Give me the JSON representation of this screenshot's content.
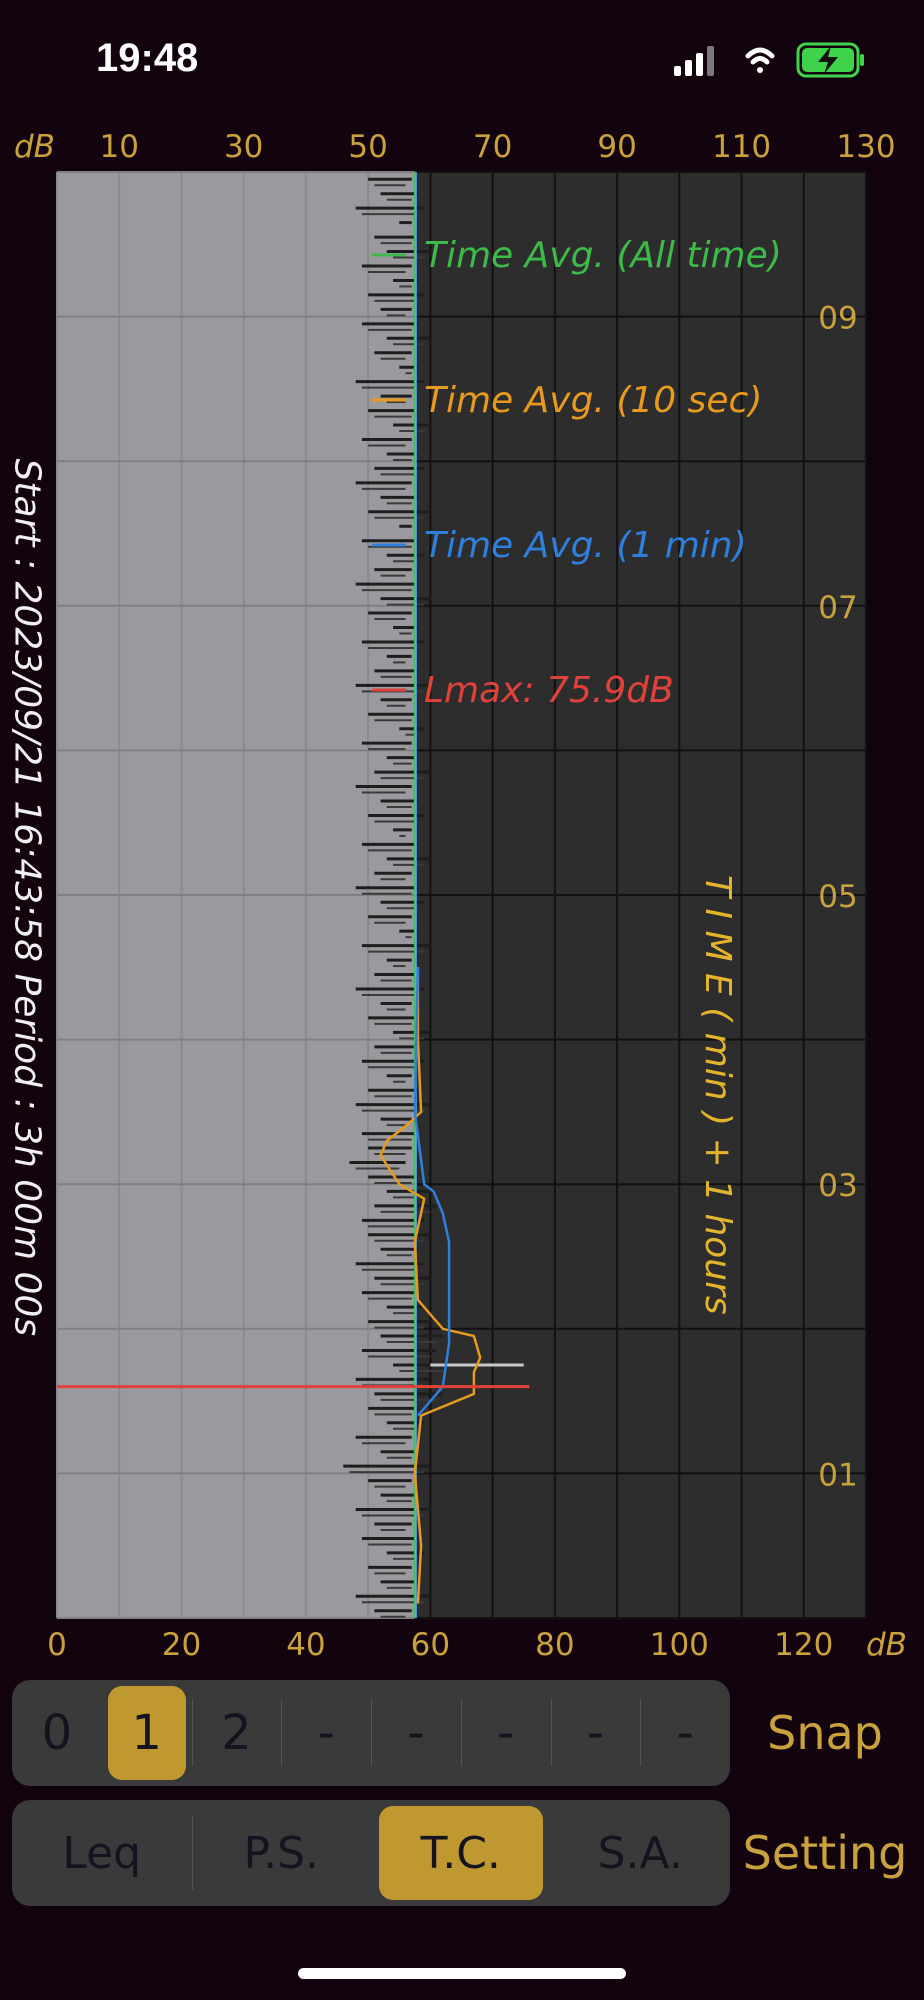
{
  "status_bar": {
    "time": "19:48"
  },
  "top_axis": {
    "unit": "dB",
    "labels": [
      "10",
      "30",
      "50",
      "70",
      "90",
      "110",
      "130"
    ]
  },
  "bottom_axis": {
    "unit": "dB",
    "labels": [
      "0",
      "20",
      "40",
      "60",
      "80",
      "100",
      "120"
    ]
  },
  "right_axis": {
    "labels": [
      "09",
      "07",
      "05",
      "03",
      "01"
    ],
    "title": "T I M E ( min ) + 1 hours"
  },
  "left_info": "Start : 2023/09/21 16:43:58  Period : 3h 00m 00s",
  "legend": [
    {
      "label": "Time Avg. (All time)",
      "color": "#3dbb4a"
    },
    {
      "label": "Time Avg. (10 sec)",
      "color": "#e79a1e"
    },
    {
      "label": "Time Avg. (1 min)",
      "color": "#2f7fdc"
    },
    {
      "label": "Lmax: 75.9dB",
      "color": "#e0423a"
    }
  ],
  "colors": {
    "accent": "#bf9830",
    "lmax": "#e0423a",
    "all_time": "#3dbb4a",
    "ten_sec": "#e79a1e",
    "one_min": "#2f7fdc",
    "gray_fill": "#9a9a9e",
    "dark_fill": "#2d2d2d"
  },
  "chart_data": {
    "type": "line",
    "x_axis": "dB",
    "xlim": [
      0,
      130
    ],
    "y_axis": "time (min)",
    "ylim": [
      0,
      10
    ],
    "current_level_db": 57.5,
    "lmax_db": 75.9,
    "lmax_time_min": 1.6,
    "all_time_avg_db": 57.5,
    "series": [
      {
        "name": "Time Avg. (10 sec)",
        "points": [
          [
            58,
            0.1
          ],
          [
            58.5,
            0.5
          ],
          [
            57.5,
            1.0
          ],
          [
            58.5,
            1.4
          ],
          [
            67,
            1.55
          ],
          [
            67,
            1.7
          ],
          [
            68,
            1.8
          ],
          [
            67,
            1.95
          ],
          [
            62,
            2.0
          ],
          [
            58,
            2.2
          ],
          [
            57.5,
            2.6
          ],
          [
            59,
            2.9
          ],
          [
            55,
            3.0
          ],
          [
            52,
            3.2
          ],
          [
            53,
            3.3
          ],
          [
            56,
            3.4
          ],
          [
            58.5,
            3.5
          ],
          [
            58,
            4.0
          ],
          [
            58,
            4.5
          ]
        ]
      },
      {
        "name": "Time Avg. (1 min)",
        "points": [
          [
            58,
            1.4
          ],
          [
            62,
            1.6
          ],
          [
            63,
            1.9
          ],
          [
            63,
            2.6
          ],
          [
            62,
            2.8
          ],
          [
            60.5,
            2.95
          ],
          [
            59,
            3.0
          ],
          [
            57.5,
            3.5
          ],
          [
            58,
            4.5
          ]
        ]
      }
    ],
    "spectrum_dark_bars": [
      [
        9.95,
        57,
        50
      ],
      [
        9.85,
        58,
        52
      ],
      [
        9.75,
        59,
        48
      ],
      [
        9.65,
        57,
        55
      ],
      [
        9.55,
        58,
        51
      ],
      [
        9.45,
        60,
        53
      ],
      [
        9.35,
        57,
        49
      ],
      [
        9.25,
        58,
        54
      ],
      [
        9.15,
        59,
        50
      ],
      [
        9.05,
        57,
        52
      ],
      [
        8.95,
        58,
        49
      ],
      [
        8.85,
        60,
        53
      ],
      [
        8.75,
        57,
        51
      ],
      [
        8.65,
        58,
        55
      ],
      [
        8.55,
        59,
        48
      ],
      [
        8.45,
        57,
        52
      ],
      [
        8.35,
        58,
        50
      ],
      [
        8.25,
        60,
        54
      ],
      [
        8.15,
        57,
        49
      ],
      [
        8.05,
        58,
        53
      ],
      [
        7.95,
        59,
        51
      ],
      [
        7.85,
        57,
        48
      ],
      [
        7.75,
        58,
        52
      ],
      [
        7.65,
        60,
        50
      ],
      [
        7.55,
        57,
        55
      ],
      [
        7.45,
        58,
        49
      ],
      [
        7.35,
        59,
        53
      ],
      [
        7.25,
        57,
        51
      ],
      [
        7.15,
        58,
        48
      ],
      [
        7.05,
        60,
        52
      ],
      [
        6.95,
        57,
        50
      ],
      [
        6.85,
        58,
        54
      ],
      [
        6.75,
        59,
        49
      ],
      [
        6.65,
        57,
        53
      ],
      [
        6.55,
        58,
        51
      ],
      [
        6.45,
        60,
        48
      ],
      [
        6.35,
        57,
        52
      ],
      [
        6.25,
        58,
        50
      ],
      [
        6.15,
        59,
        55
      ],
      [
        6.05,
        57,
        49
      ],
      [
        5.95,
        58,
        53
      ],
      [
        5.85,
        60,
        51
      ],
      [
        5.75,
        57,
        48
      ],
      [
        5.65,
        58,
        52
      ],
      [
        5.55,
        59,
        50
      ],
      [
        5.45,
        57,
        54
      ],
      [
        5.35,
        58,
        49
      ],
      [
        5.25,
        60,
        53
      ],
      [
        5.15,
        57,
        51
      ],
      [
        5.05,
        58,
        48
      ],
      [
        4.95,
        59,
        52
      ],
      [
        4.85,
        57,
        50
      ],
      [
        4.75,
        58,
        55
      ],
      [
        4.65,
        60,
        49
      ],
      [
        4.55,
        57,
        53
      ],
      [
        4.45,
        58,
        51
      ],
      [
        4.35,
        59,
        48
      ],
      [
        4.25,
        57,
        52
      ],
      [
        4.15,
        58,
        50
      ],
      [
        4.05,
        60,
        54
      ],
      [
        3.95,
        58,
        51
      ],
      [
        3.85,
        59,
        49
      ],
      [
        3.75,
        57,
        53
      ],
      [
        3.65,
        58,
        50
      ],
      [
        3.55,
        60,
        48
      ],
      [
        3.45,
        57,
        52
      ],
      [
        3.35,
        58,
        49
      ],
      [
        3.25,
        57,
        50
      ],
      [
        3.15,
        56,
        47
      ],
      [
        3.05,
        58,
        50
      ],
      [
        2.95,
        60,
        53
      ],
      [
        2.85,
        61,
        51
      ],
      [
        2.75,
        59,
        49
      ],
      [
        2.65,
        60,
        50
      ],
      [
        2.55,
        58,
        52
      ],
      [
        2.45,
        59,
        48
      ],
      [
        2.35,
        60,
        51
      ],
      [
        2.25,
        58,
        49
      ],
      [
        2.15,
        59,
        53
      ],
      [
        2.05,
        60,
        50
      ],
      [
        1.95,
        62,
        52
      ],
      [
        1.85,
        61,
        49
      ],
      [
        1.75,
        63,
        54
      ],
      [
        1.65,
        60,
        48
      ],
      [
        1.55,
        62,
        51
      ],
      [
        1.45,
        58,
        50
      ],
      [
        1.35,
        59,
        53
      ],
      [
        1.25,
        57,
        48
      ],
      [
        1.15,
        58,
        52
      ],
      [
        1.05,
        60,
        46
      ],
      [
        0.95,
        57,
        50
      ],
      [
        0.85,
        58,
        52
      ],
      [
        0.75,
        60,
        48
      ],
      [
        0.65,
        57,
        51
      ],
      [
        0.55,
        58,
        49
      ],
      [
        0.45,
        59,
        53
      ],
      [
        0.35,
        57,
        50
      ],
      [
        0.25,
        58,
        52
      ],
      [
        0.15,
        60,
        48
      ],
      [
        0.05,
        57,
        51
      ]
    ]
  },
  "channel_selector": {
    "items": [
      "0",
      "1",
      "2",
      "-",
      "-",
      "-",
      "-",
      "-"
    ],
    "active_index": 1
  },
  "snap_label": "Snap",
  "mode_tabs": {
    "items": [
      "Leq",
      "P.S.",
      "T.C.",
      "S.A."
    ],
    "active_index": 2
  },
  "setting_label": "Setting"
}
